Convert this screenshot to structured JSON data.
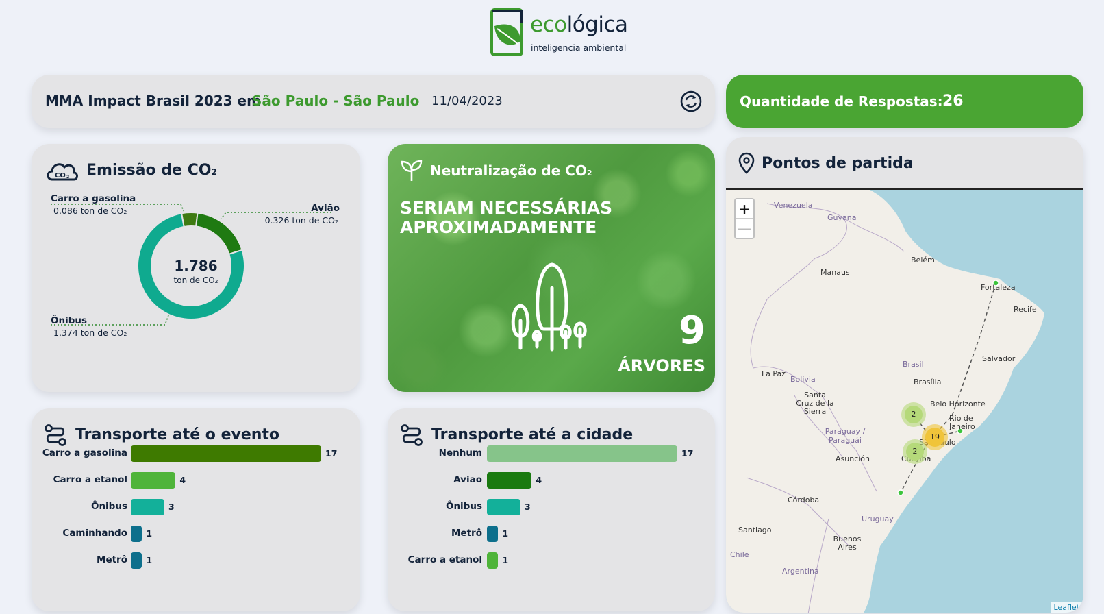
{
  "logo": {
    "name_green": "eco",
    "name_dark": "lógica",
    "tagline": "inteligencia ambiental"
  },
  "header": {
    "title": "MMA Impact Brasil 2023 em",
    "place": "São Paulo - São Paulo",
    "date": "11/04/2023",
    "refresh_icon": "refresh-icon"
  },
  "responses": {
    "label": "Quantidade de Respostas:",
    "value": "26"
  },
  "emission": {
    "title": "Emissão de CO",
    "title_sub": "2",
    "total": "1.786",
    "total_unit": "ton de CO₂",
    "segments": [
      {
        "name": "Carro a gasolina",
        "value_text": "0.086 ton de CO₂",
        "value": 0.086,
        "color": "#3e7a11"
      },
      {
        "name": "Avião",
        "value_text": "0.326 ton de CO₂",
        "value": 0.326,
        "color": "#1f7a12"
      },
      {
        "name": "Ônibus",
        "value_text": "1.374 ton de CO₂",
        "value": 1.374,
        "color": "#0faa8f"
      }
    ]
  },
  "neutralization": {
    "title": "Neutralização de CO",
    "title_sub": "2",
    "text": "SERIAM NECESSÁRIAS APROXIMADAMENTE",
    "count": "9",
    "unit": "ÁRVORES"
  },
  "transport_event": {
    "title": "Transporte até o evento",
    "max": 17,
    "rows": [
      {
        "label": "Carro a gasolina",
        "value": 17,
        "color": "#3e7a00"
      },
      {
        "label": "Carro a etanol",
        "value": 4,
        "color": "#4fb43a"
      },
      {
        "label": "Ônibus",
        "value": 3,
        "color": "#13b09a"
      },
      {
        "label": "Caminhando",
        "value": 1,
        "color": "#0d6f8c"
      },
      {
        "label": "Metrô",
        "value": 1,
        "color": "#0d6f8c"
      }
    ]
  },
  "transport_city": {
    "title": "Transporte até a cidade",
    "max": 17,
    "rows": [
      {
        "label": "Nenhum",
        "value": 17,
        "color": "#86c48a"
      },
      {
        "label": "Avião",
        "value": 4,
        "color": "#1a7a10"
      },
      {
        "label": "Ônibus",
        "value": 3,
        "color": "#13b09a"
      },
      {
        "label": "Metrô",
        "value": 1,
        "color": "#0d6f8c"
      },
      {
        "label": "Carro a etanol",
        "value": 1,
        "color": "#4fb43a"
      }
    ]
  },
  "map": {
    "title": "Pontos de partida",
    "zoom_in": "+",
    "zoom_out": "—",
    "attribution": "Leaflet",
    "labels": {
      "venezuela": "Venezuela",
      "guyana": "Guyana",
      "manaus": "Manaus",
      "belem": "Belém",
      "fortaleza": "Fortaleza",
      "recife": "Recife",
      "salvador": "Salvador",
      "brasil": "Brasil",
      "brasilia": "Brasília",
      "lapaz": "La Paz",
      "bolivia": "Bolivia",
      "santacruz": "Santa Cruz de la Sierra",
      "belohorizonte": "Belo Horizonte",
      "riodejaneiro": "Rio de Janeiro",
      "saopaulo": "São Paulo",
      "curitiba": "Curitiba",
      "paraguay": "Paraguay / Paraguái",
      "asuncion": "Asunción",
      "cordoba": "Córdoba",
      "uruguay": "Uruguay",
      "santiago": "Santiago",
      "buenosaires": "Buenos Aires",
      "chile": "Chile",
      "argentina": "Argentina"
    },
    "clusters": [
      {
        "count": "2",
        "color": "#b5d97a"
      },
      {
        "count": "19",
        "color": "#f0c43a"
      },
      {
        "count": "2",
        "color": "#b5d97a"
      }
    ]
  }
}
